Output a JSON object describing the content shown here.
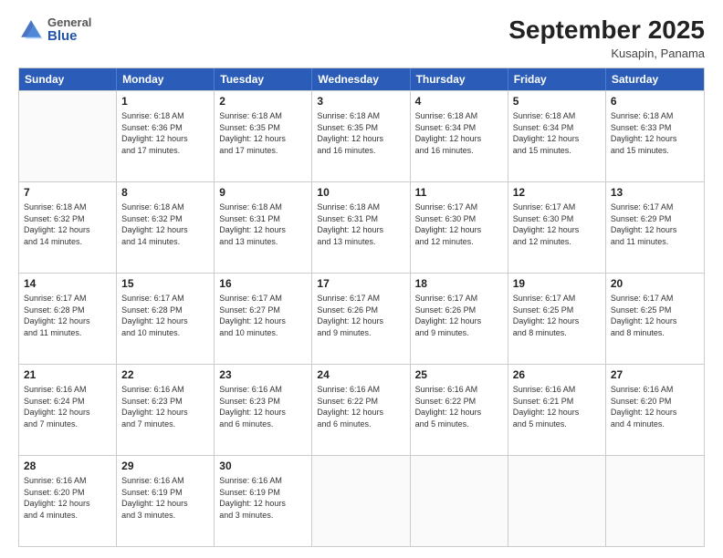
{
  "header": {
    "logo_general": "General",
    "logo_blue": "Blue",
    "month_title": "September 2025",
    "subtitle": "Kusapin, Panama"
  },
  "days_of_week": [
    "Sunday",
    "Monday",
    "Tuesday",
    "Wednesday",
    "Thursday",
    "Friday",
    "Saturday"
  ],
  "weeks": [
    [
      {
        "day": "",
        "info": ""
      },
      {
        "day": "1",
        "info": "Sunrise: 6:18 AM\nSunset: 6:36 PM\nDaylight: 12 hours\nand 17 minutes."
      },
      {
        "day": "2",
        "info": "Sunrise: 6:18 AM\nSunset: 6:35 PM\nDaylight: 12 hours\nand 17 minutes."
      },
      {
        "day": "3",
        "info": "Sunrise: 6:18 AM\nSunset: 6:35 PM\nDaylight: 12 hours\nand 16 minutes."
      },
      {
        "day": "4",
        "info": "Sunrise: 6:18 AM\nSunset: 6:34 PM\nDaylight: 12 hours\nand 16 minutes."
      },
      {
        "day": "5",
        "info": "Sunrise: 6:18 AM\nSunset: 6:34 PM\nDaylight: 12 hours\nand 15 minutes."
      },
      {
        "day": "6",
        "info": "Sunrise: 6:18 AM\nSunset: 6:33 PM\nDaylight: 12 hours\nand 15 minutes."
      }
    ],
    [
      {
        "day": "7",
        "info": "Sunrise: 6:18 AM\nSunset: 6:32 PM\nDaylight: 12 hours\nand 14 minutes."
      },
      {
        "day": "8",
        "info": "Sunrise: 6:18 AM\nSunset: 6:32 PM\nDaylight: 12 hours\nand 14 minutes."
      },
      {
        "day": "9",
        "info": "Sunrise: 6:18 AM\nSunset: 6:31 PM\nDaylight: 12 hours\nand 13 minutes."
      },
      {
        "day": "10",
        "info": "Sunrise: 6:18 AM\nSunset: 6:31 PM\nDaylight: 12 hours\nand 13 minutes."
      },
      {
        "day": "11",
        "info": "Sunrise: 6:17 AM\nSunset: 6:30 PM\nDaylight: 12 hours\nand 12 minutes."
      },
      {
        "day": "12",
        "info": "Sunrise: 6:17 AM\nSunset: 6:30 PM\nDaylight: 12 hours\nand 12 minutes."
      },
      {
        "day": "13",
        "info": "Sunrise: 6:17 AM\nSunset: 6:29 PM\nDaylight: 12 hours\nand 11 minutes."
      }
    ],
    [
      {
        "day": "14",
        "info": "Sunrise: 6:17 AM\nSunset: 6:28 PM\nDaylight: 12 hours\nand 11 minutes."
      },
      {
        "day": "15",
        "info": "Sunrise: 6:17 AM\nSunset: 6:28 PM\nDaylight: 12 hours\nand 10 minutes."
      },
      {
        "day": "16",
        "info": "Sunrise: 6:17 AM\nSunset: 6:27 PM\nDaylight: 12 hours\nand 10 minutes."
      },
      {
        "day": "17",
        "info": "Sunrise: 6:17 AM\nSunset: 6:26 PM\nDaylight: 12 hours\nand 9 minutes."
      },
      {
        "day": "18",
        "info": "Sunrise: 6:17 AM\nSunset: 6:26 PM\nDaylight: 12 hours\nand 9 minutes."
      },
      {
        "day": "19",
        "info": "Sunrise: 6:17 AM\nSunset: 6:25 PM\nDaylight: 12 hours\nand 8 minutes."
      },
      {
        "day": "20",
        "info": "Sunrise: 6:17 AM\nSunset: 6:25 PM\nDaylight: 12 hours\nand 8 minutes."
      }
    ],
    [
      {
        "day": "21",
        "info": "Sunrise: 6:16 AM\nSunset: 6:24 PM\nDaylight: 12 hours\nand 7 minutes."
      },
      {
        "day": "22",
        "info": "Sunrise: 6:16 AM\nSunset: 6:23 PM\nDaylight: 12 hours\nand 7 minutes."
      },
      {
        "day": "23",
        "info": "Sunrise: 6:16 AM\nSunset: 6:23 PM\nDaylight: 12 hours\nand 6 minutes."
      },
      {
        "day": "24",
        "info": "Sunrise: 6:16 AM\nSunset: 6:22 PM\nDaylight: 12 hours\nand 6 minutes."
      },
      {
        "day": "25",
        "info": "Sunrise: 6:16 AM\nSunset: 6:22 PM\nDaylight: 12 hours\nand 5 minutes."
      },
      {
        "day": "26",
        "info": "Sunrise: 6:16 AM\nSunset: 6:21 PM\nDaylight: 12 hours\nand 5 minutes."
      },
      {
        "day": "27",
        "info": "Sunrise: 6:16 AM\nSunset: 6:20 PM\nDaylight: 12 hours\nand 4 minutes."
      }
    ],
    [
      {
        "day": "28",
        "info": "Sunrise: 6:16 AM\nSunset: 6:20 PM\nDaylight: 12 hours\nand 4 minutes."
      },
      {
        "day": "29",
        "info": "Sunrise: 6:16 AM\nSunset: 6:19 PM\nDaylight: 12 hours\nand 3 minutes."
      },
      {
        "day": "30",
        "info": "Sunrise: 6:16 AM\nSunset: 6:19 PM\nDaylight: 12 hours\nand 3 minutes."
      },
      {
        "day": "",
        "info": ""
      },
      {
        "day": "",
        "info": ""
      },
      {
        "day": "",
        "info": ""
      },
      {
        "day": "",
        "info": ""
      }
    ]
  ]
}
